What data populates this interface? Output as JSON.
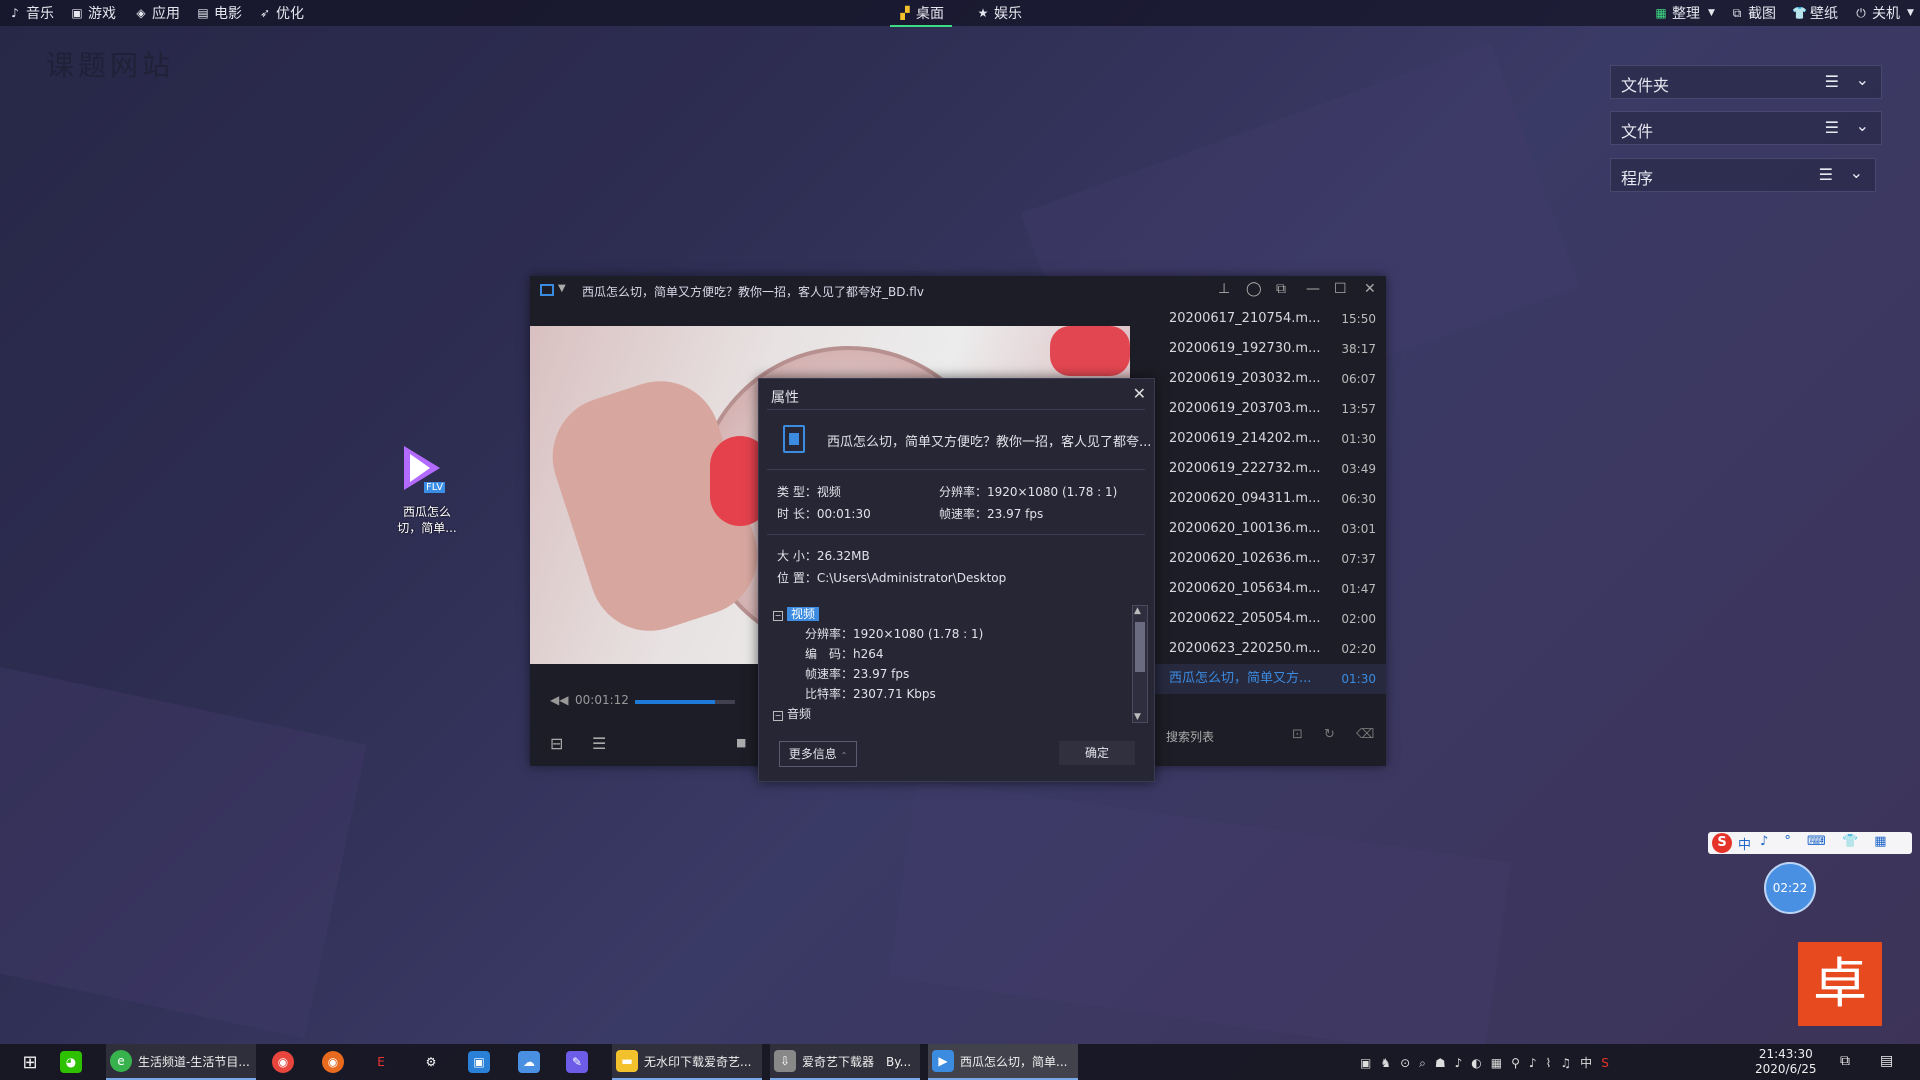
{
  "topbar": {
    "left_items": [
      "音乐",
      "游戏",
      "应用",
      "电影",
      "优化"
    ],
    "tabs": [
      "桌面",
      "娱乐"
    ],
    "right_items": [
      "整理",
      "截图",
      "壁纸",
      "关机"
    ]
  },
  "watermark": "课题网站",
  "right_panels": [
    "文件夹",
    "文件",
    "程序"
  ],
  "desktop_icon": {
    "badge": "FLV",
    "name_line1": "西瓜怎么",
    "name_line2": "切，简单..."
  },
  "player": {
    "title": "西瓜怎么切，简单又方便吃？教你一招，客人见了都夸好_BD.flv",
    "current_time": "00:01:12",
    "progress": 0.8,
    "playlist": [
      {
        "name": "20200617_210754.m...",
        "duration": "15:50"
      },
      {
        "name": "20200619_192730.m...",
        "duration": "38:17"
      },
      {
        "name": "20200619_203032.m...",
        "duration": "06:07"
      },
      {
        "name": "20200619_203703.m...",
        "duration": "13:57"
      },
      {
        "name": "20200619_214202.m...",
        "duration": "01:30"
      },
      {
        "name": "20200619_222732.m...",
        "duration": "03:49"
      },
      {
        "name": "20200620_094311.m...",
        "duration": "06:30"
      },
      {
        "name": "20200620_100136.m...",
        "duration": "03:01"
      },
      {
        "name": "20200620_102636.m...",
        "duration": "07:37"
      },
      {
        "name": "20200620_105634.m...",
        "duration": "01:47"
      },
      {
        "name": "20200622_205054.m...",
        "duration": "02:00"
      },
      {
        "name": "20200623_220250.m...",
        "duration": "02:20"
      },
      {
        "name": "西瓜怎么切，简单又方...",
        "duration": "01:30"
      }
    ],
    "search_label": "搜索列表"
  },
  "dialog": {
    "title": "属性",
    "filename": "西瓜怎么切，简单又方便吃？教你一招，客人见了都夸...",
    "type": "类 型：视频",
    "resolution": "分辨率：1920×1080 (1.78 : 1)",
    "duration": "时 长：00:01:30",
    "framerate": "帧速率：23.97 fps",
    "size": "大 小：26.32MB",
    "location": "位 置：C:\\Users\\Administrator\\Desktop",
    "tree": {
      "video_label": "视频",
      "v_resolution": "分辨率：1920×1080 (1.78 : 1)",
      "v_codec": "编　码：h264",
      "v_framerate": "帧速率：23.97 fps",
      "v_bitrate": "比特率：2307.71 Kbps",
      "audio_label": "音频"
    },
    "more_button": "更多信息",
    "ok_button": "确定"
  },
  "ime": {
    "zh": "中",
    "rest": "♪ ° ⌨ 👕 ▦"
  },
  "clock_bubble": "02:22",
  "taskbar": {
    "items": [
      "生活频道-生活节目...",
      "无水印下载爱奇艺...",
      "爱奇艺下载器　By...",
      "西瓜怎么切，简单..."
    ],
    "clock_time": "21:43:30",
    "clock_date": "2020/6/25",
    "tray_zh": "中"
  }
}
